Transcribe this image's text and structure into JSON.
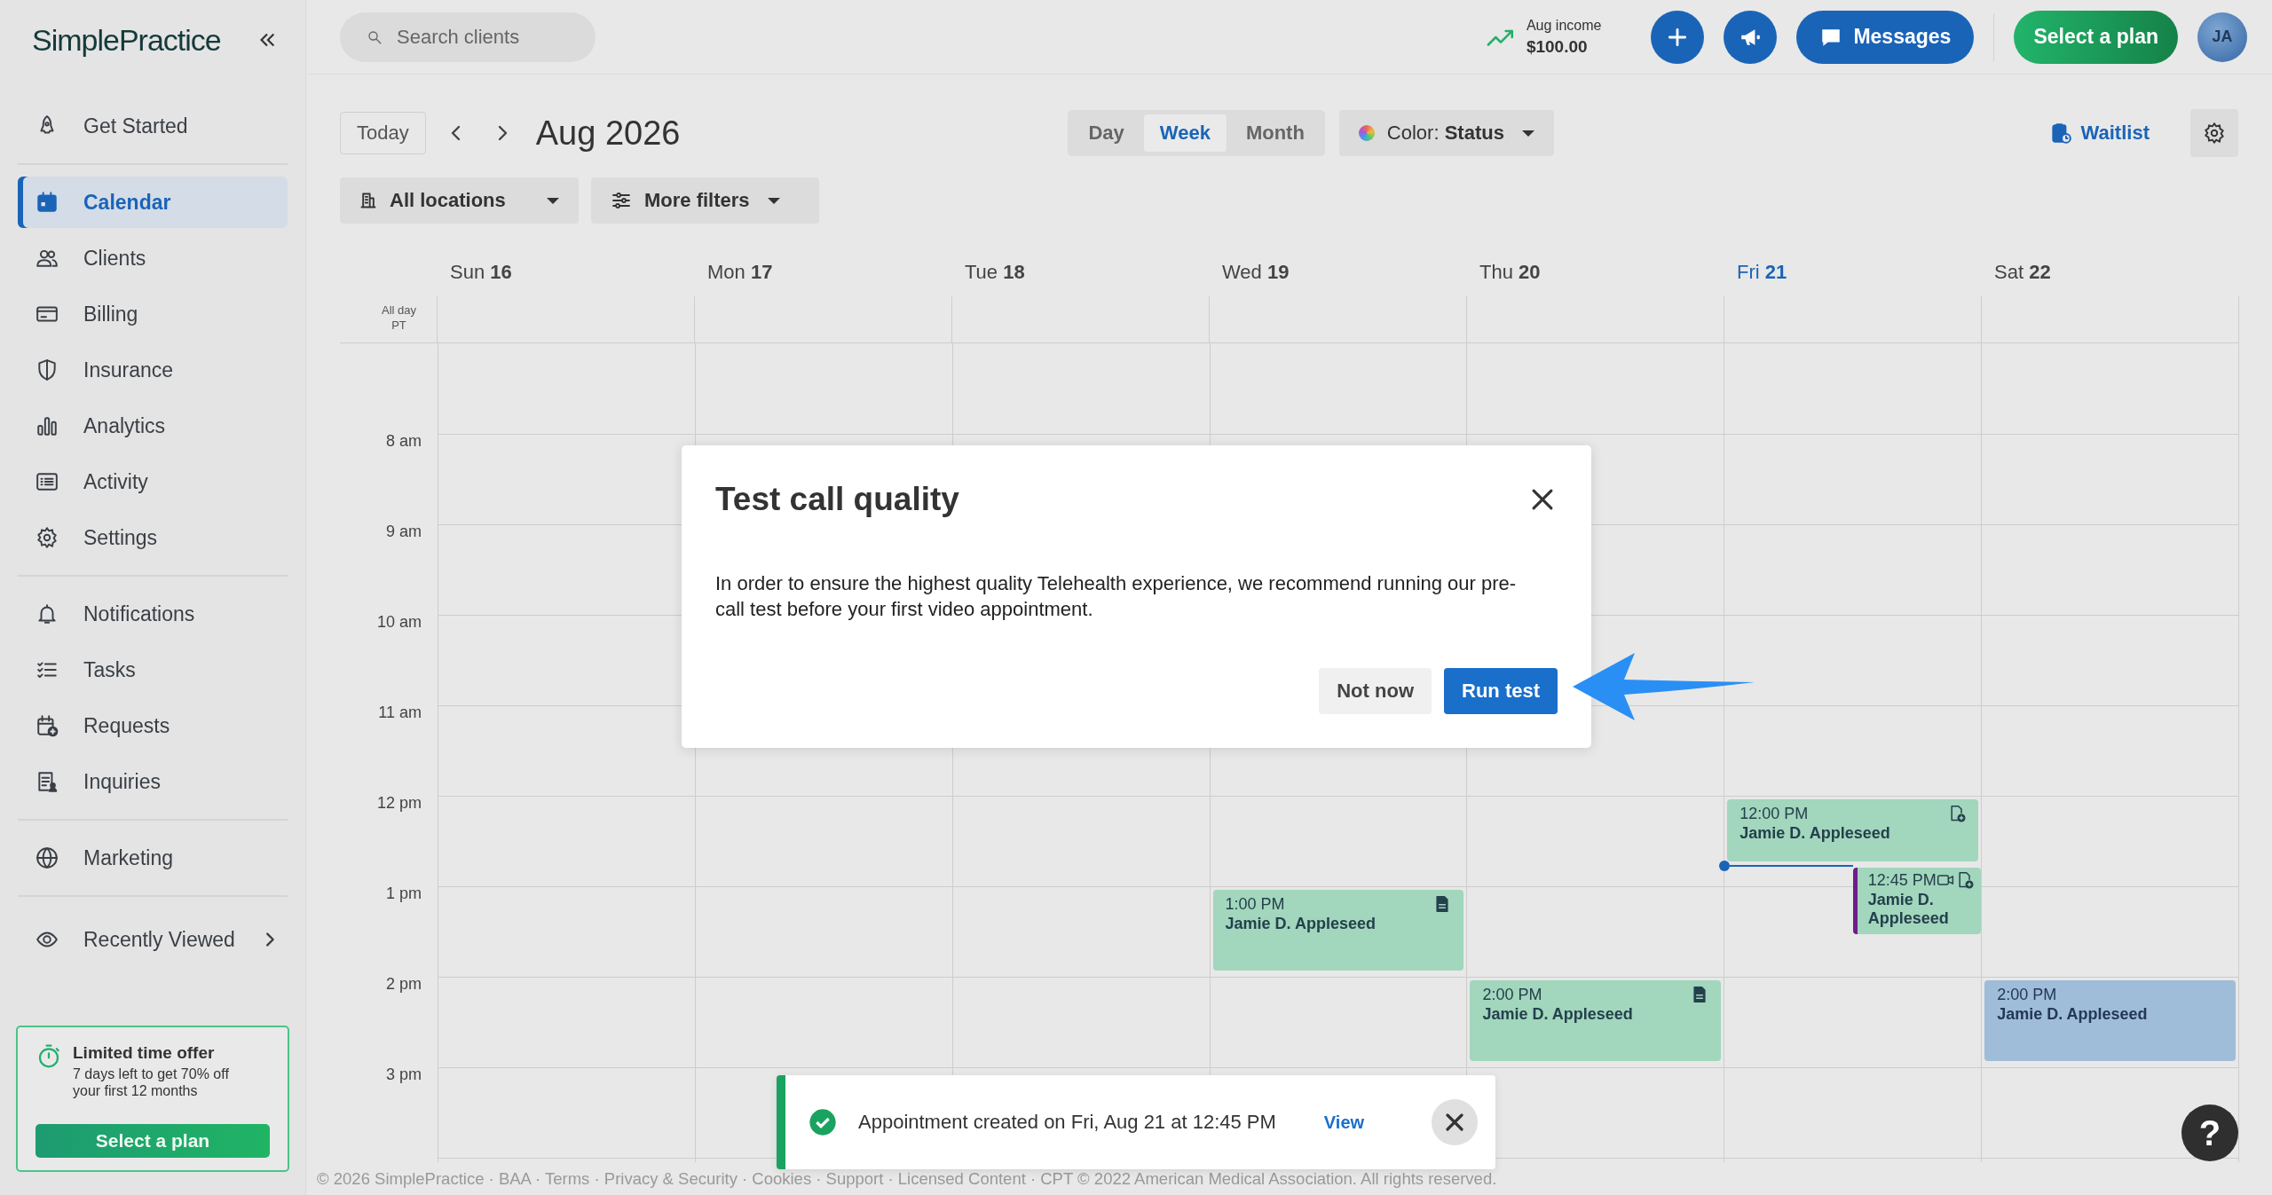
{
  "sidebar": {
    "logo": "SimplePractice",
    "sections": [
      [
        {
          "label": "Get Started",
          "selected": false
        }
      ],
      [
        {
          "label": "Calendar",
          "selected": true
        },
        {
          "label": "Clients",
          "selected": false
        },
        {
          "label": "Billing",
          "selected": false
        },
        {
          "label": "Insurance",
          "selected": false
        },
        {
          "label": "Analytics",
          "selected": false
        },
        {
          "label": "Activity",
          "selected": false
        },
        {
          "label": "Settings",
          "selected": false
        }
      ],
      [
        {
          "label": "Notifications",
          "selected": false
        },
        {
          "label": "Tasks",
          "selected": false
        },
        {
          "label": "Requests",
          "selected": false
        },
        {
          "label": "Inquiries",
          "selected": false
        }
      ],
      [
        {
          "label": "Marketing",
          "selected": false
        }
      ],
      [
        {
          "label": "Recently Viewed",
          "selected": false
        }
      ]
    ],
    "promo": {
      "title": "Limited time offer",
      "text": "7 days left to get 70% off your first 12 months",
      "button": "Select a plan"
    }
  },
  "topbar": {
    "search": {
      "placeholder": "Search clients"
    },
    "income_label": "Aug income",
    "income_value": "$100.00",
    "messages": "Messages",
    "plan": "Select a plan",
    "avatar": "JA"
  },
  "toolbar": {
    "today": "Today",
    "title": "Aug 2026",
    "views": [
      {
        "label": "Day",
        "selected": false
      },
      {
        "label": "Week",
        "selected": true
      },
      {
        "label": "Month",
        "selected": false
      }
    ],
    "color_filter": {
      "label": "Color:",
      "value": "Status"
    },
    "waitlist": "Waitlist",
    "locations": "All locations",
    "filters": "More filters"
  },
  "calendar": {
    "all_day": "All day",
    "timezone": "PT",
    "hours": [
      "8 am",
      "9 am",
      "10 am",
      "11 am",
      "12 pm",
      "1 pm",
      "2 pm",
      "3 pm"
    ],
    "days": [
      {
        "weekday": "Sun",
        "date": "16",
        "selected": false
      },
      {
        "weekday": "Mon",
        "date": "17",
        "selected": false
      },
      {
        "weekday": "Tue",
        "date": "18",
        "selected": false
      },
      {
        "weekday": "Wed",
        "date": "19",
        "selected": false,
        "events": [
          {
            "time": "1:00 PM",
            "name": "Jamie D. Appleseed",
            "color": "#a2d6bd",
            "kind": "note"
          }
        ]
      },
      {
        "weekday": "Thu",
        "date": "20",
        "selected": false,
        "events": [
          {
            "time": "2:00 PM",
            "name": "Jamie D. Appleseed",
            "color": "#a2d6bd",
            "kind": "note"
          }
        ]
      },
      {
        "weekday": "Fri",
        "date": "21",
        "selected": true,
        "current_time_marker": true,
        "events": [
          {
            "time": "12:00 PM",
            "name": "Jamie D. Appleseed",
            "color": "#a2d6bd",
            "kind": "pending"
          },
          {
            "time": "12:45 PM",
            "name": "Jamie D. Appleseed",
            "color": "#a2d6bd",
            "kind": "telehealth",
            "overlapping": true,
            "accent": true
          }
        ]
      },
      {
        "weekday": "Sat",
        "date": "22",
        "selected": false,
        "events": [
          {
            "time": "2:00 PM",
            "name": "Jamie D. Appleseed",
            "color": "#9fbcd9",
            "kind": "plain"
          }
        ]
      }
    ]
  },
  "modal": {
    "title": "Test call quality",
    "text": "In order to ensure the highest quality Telehealth experience, we recommend running our pre-call test before your first video appointment.",
    "buttons": [
      {
        "label": "Not now",
        "kind": "secondary"
      },
      {
        "label": "Run test",
        "kind": "primary"
      }
    ]
  },
  "toast": {
    "text": "Appointment created on Fri, Aug 21 at 12:45 PM",
    "link": "View"
  },
  "footer": "© 2026 SimplePractice · BAA · Terms · Privacy & Security · Cookies · Support · Licensed Content · CPT © 2022 American Medical Association. All rights reserved.",
  "help": "?"
}
